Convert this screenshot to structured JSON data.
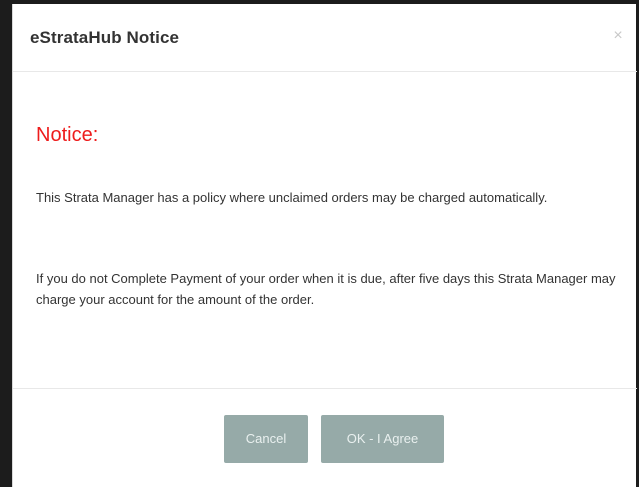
{
  "modal": {
    "title": "eStrataHub Notice",
    "close_symbol": "×",
    "notice_heading": "Notice:",
    "paragraphs": [
      "This Strata Manager has a policy where unclaimed orders may be charged automatically.",
      "If you do not Complete Payment of your order when it is due, after five days this Strata Manager may charge your account for the amount of the order."
    ],
    "buttons": {
      "cancel_label": "Cancel",
      "ok_label": "OK - I Agree"
    }
  },
  "colors": {
    "notice_heading": "#ee1c1c",
    "button_bg": "#96aaa8",
    "button_text": "#e9f0ef",
    "body_text": "#333333"
  },
  "icons": {
    "close": "close-icon"
  }
}
